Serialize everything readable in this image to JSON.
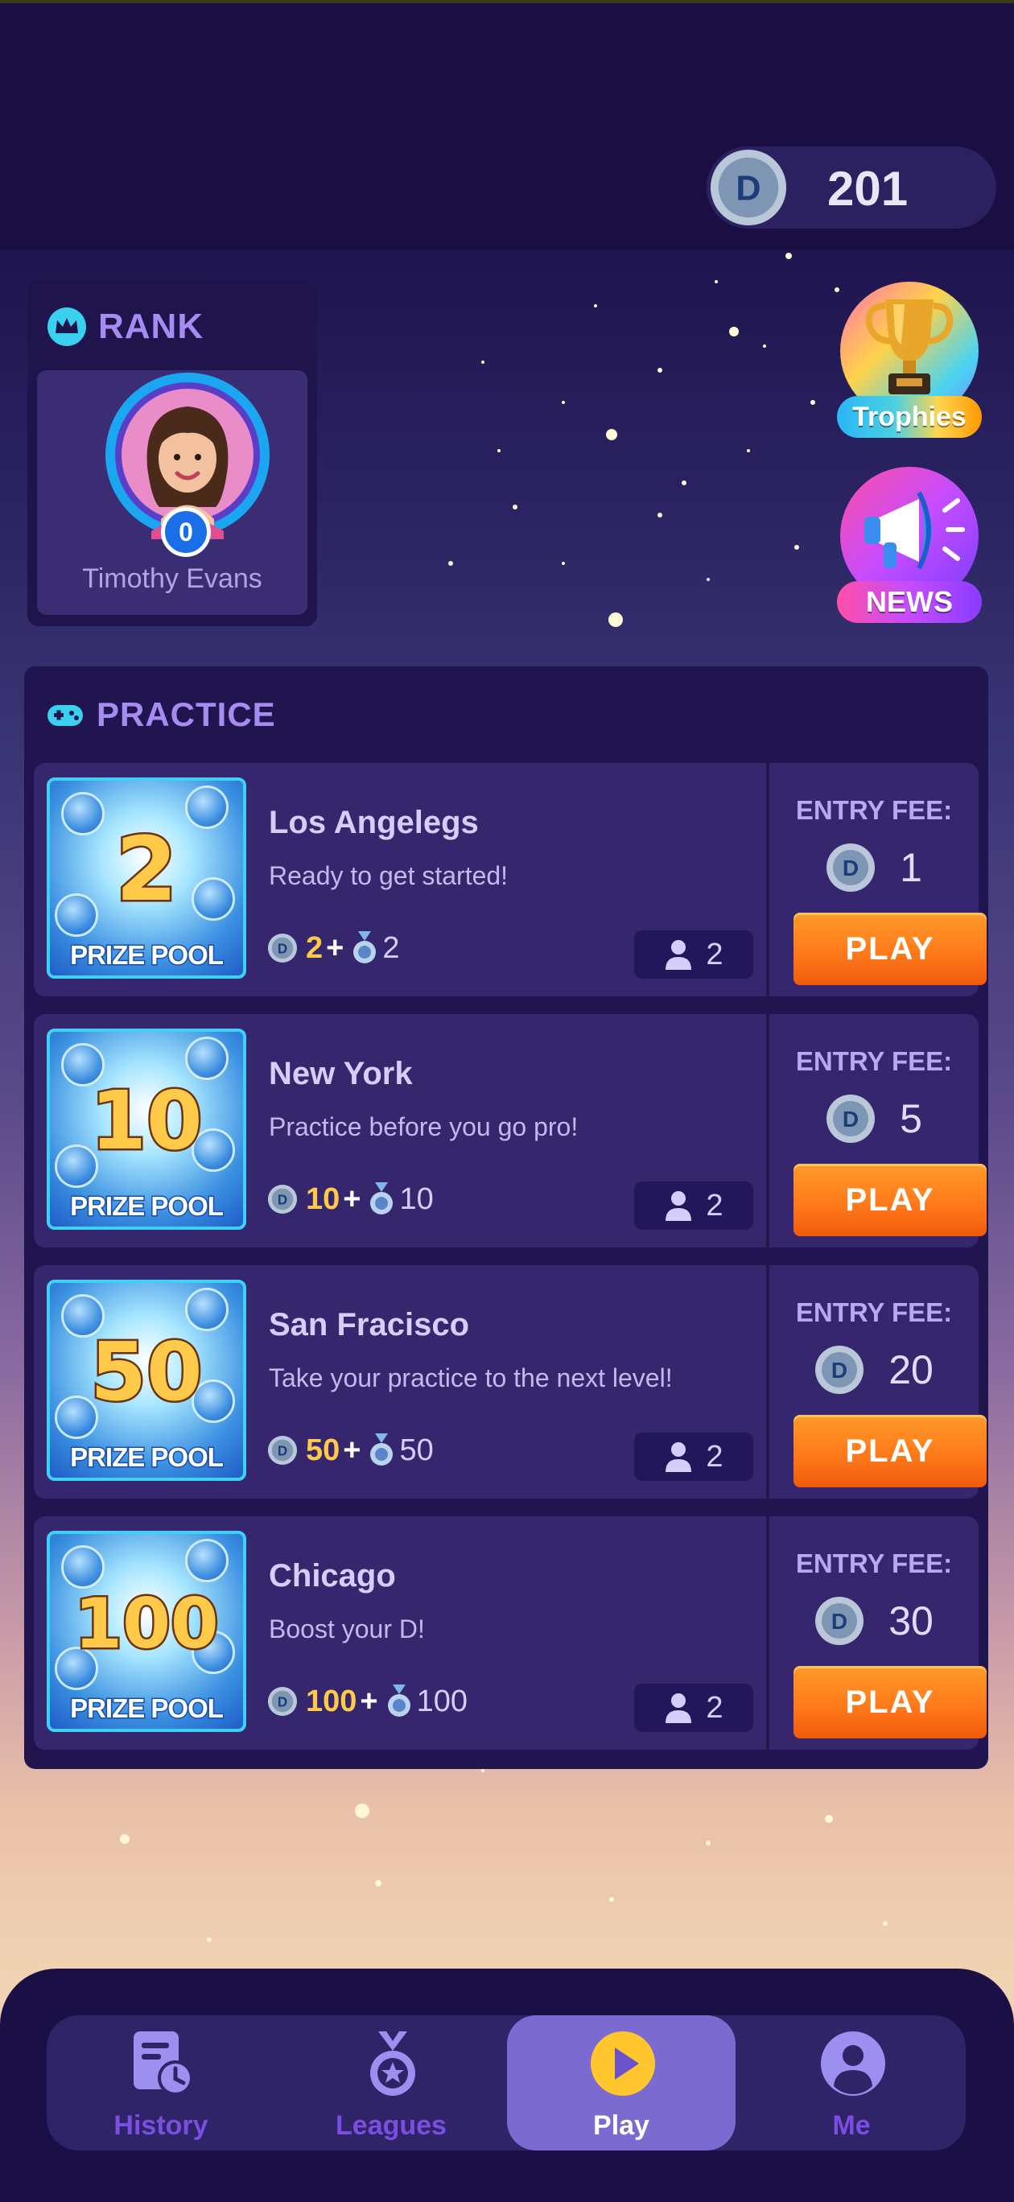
{
  "balance": {
    "amount": "201",
    "coin_letter": "D"
  },
  "rank": {
    "heading": "RANK",
    "player_name": "Timothy Evans",
    "level": "0"
  },
  "side_buttons": {
    "trophies": "Trophies",
    "news": "NEWS"
  },
  "practice": {
    "heading": "PRACTICE",
    "entry_fee_label": "ENTRY FEE:",
    "play_label": "PLAY",
    "prize_pool_label": "PRIZE POOL",
    "rooms": [
      {
        "title": "Los Angelegs",
        "description": "Ready to get started!",
        "pool": "2",
        "prize_coins": "2",
        "plus": "+",
        "prize_medals": "2",
        "players": "2",
        "fee": "1"
      },
      {
        "title": "New York",
        "description": "Practice before you go pro!",
        "pool": "10",
        "prize_coins": "10",
        "plus": "+",
        "prize_medals": "10",
        "players": "2",
        "fee": "5"
      },
      {
        "title": "San Fracisco",
        "description": "Take your practice to the next level!",
        "pool": "50",
        "prize_coins": "50",
        "plus": "+",
        "prize_medals": "50",
        "players": "2",
        "fee": "20"
      },
      {
        "title": "Chicago",
        "description": "Boost your D!",
        "pool": "100",
        "prize_coins": "100",
        "plus": "+",
        "prize_medals": "100",
        "players": "2",
        "fee": "30"
      }
    ]
  },
  "nav": {
    "items": [
      {
        "label": "History",
        "icon": "history-icon"
      },
      {
        "label": "Leagues",
        "icon": "medal-icon"
      },
      {
        "label": "Play",
        "icon": "play-icon",
        "active": true
      },
      {
        "label": "Me",
        "icon": "profile-icon"
      }
    ]
  },
  "colors": {
    "accent": "#a68cf0",
    "play_button": "#ff7a1a",
    "gold": "#ffc94a",
    "background_top": "#1a0e42"
  }
}
